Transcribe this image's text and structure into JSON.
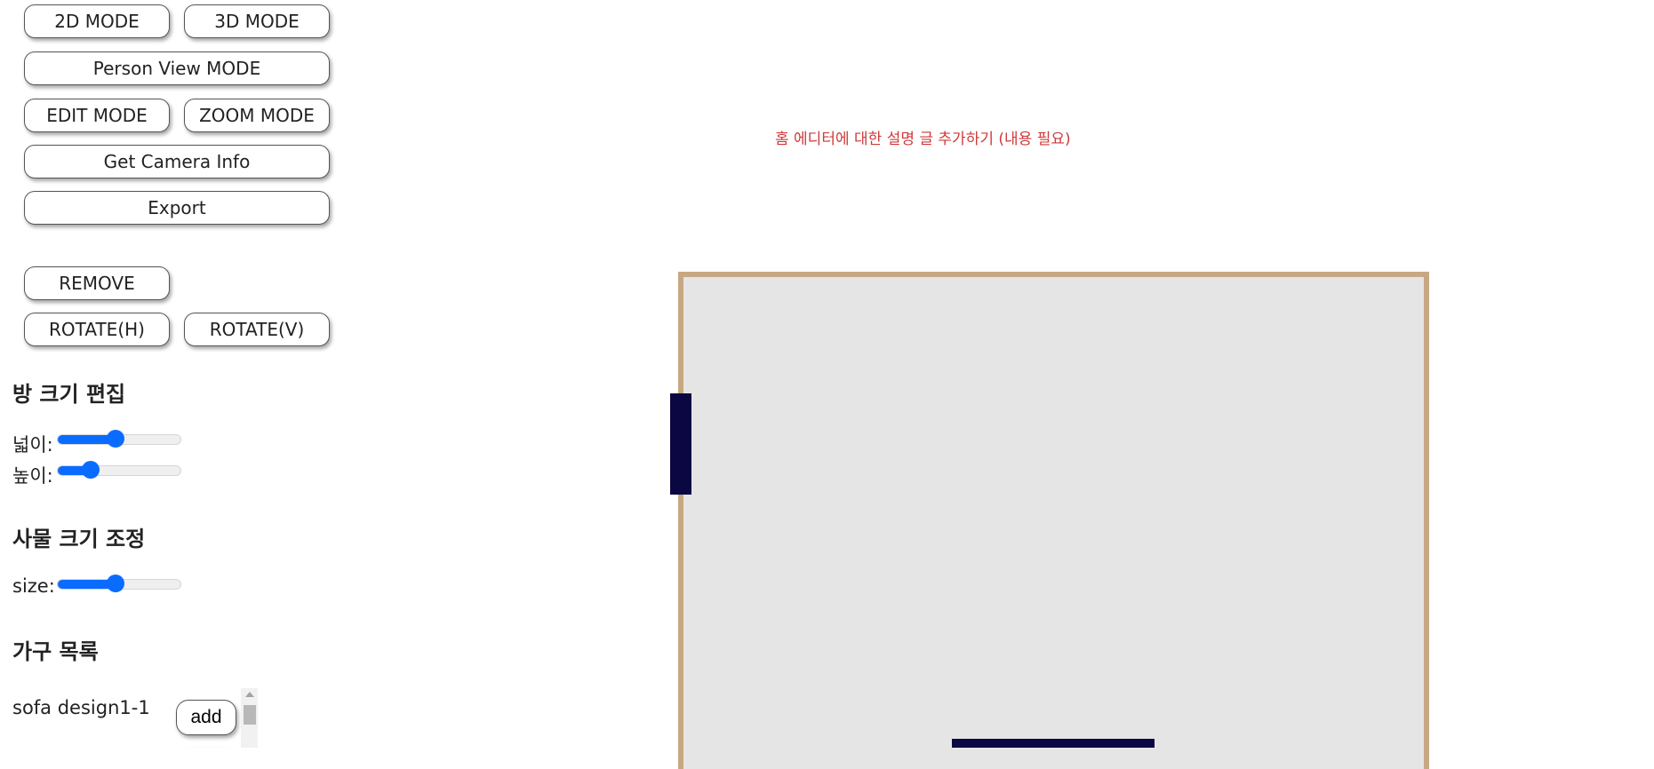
{
  "toolbar": {
    "mode_2d": "2D MODE",
    "mode_3d": "3D MODE",
    "person_view": "Person View MODE",
    "edit_mode": "EDIT MODE",
    "zoom_mode": "ZOOM MODE",
    "camera_info": "Get Camera Info",
    "export": "Export"
  },
  "object_actions": {
    "remove": "REMOVE",
    "rotate_h": "ROTATE(H)",
    "rotate_v": "ROTATE(V)"
  },
  "room_size": {
    "title": "방 크기 편집",
    "width_label": "넓이:",
    "width_value": 0.47,
    "height_label": "높이:",
    "height_value": 0.27
  },
  "object_size": {
    "title": "사물 크기 조정",
    "size_label": "size:",
    "size_value": 0.47
  },
  "furniture": {
    "title": "가구 목록",
    "items": [
      {
        "name": "sofa design1-1",
        "button": "add"
      }
    ]
  },
  "canvas": {
    "description": "홈 에디터에 대한 설명 글 추가하기 (내용 필요)"
  },
  "colors": {
    "accent": "#0a6cff",
    "wall": "#c8a882",
    "floor": "#e5e5e5",
    "door": "#0b0742",
    "description_text": "#cf3a3a"
  }
}
